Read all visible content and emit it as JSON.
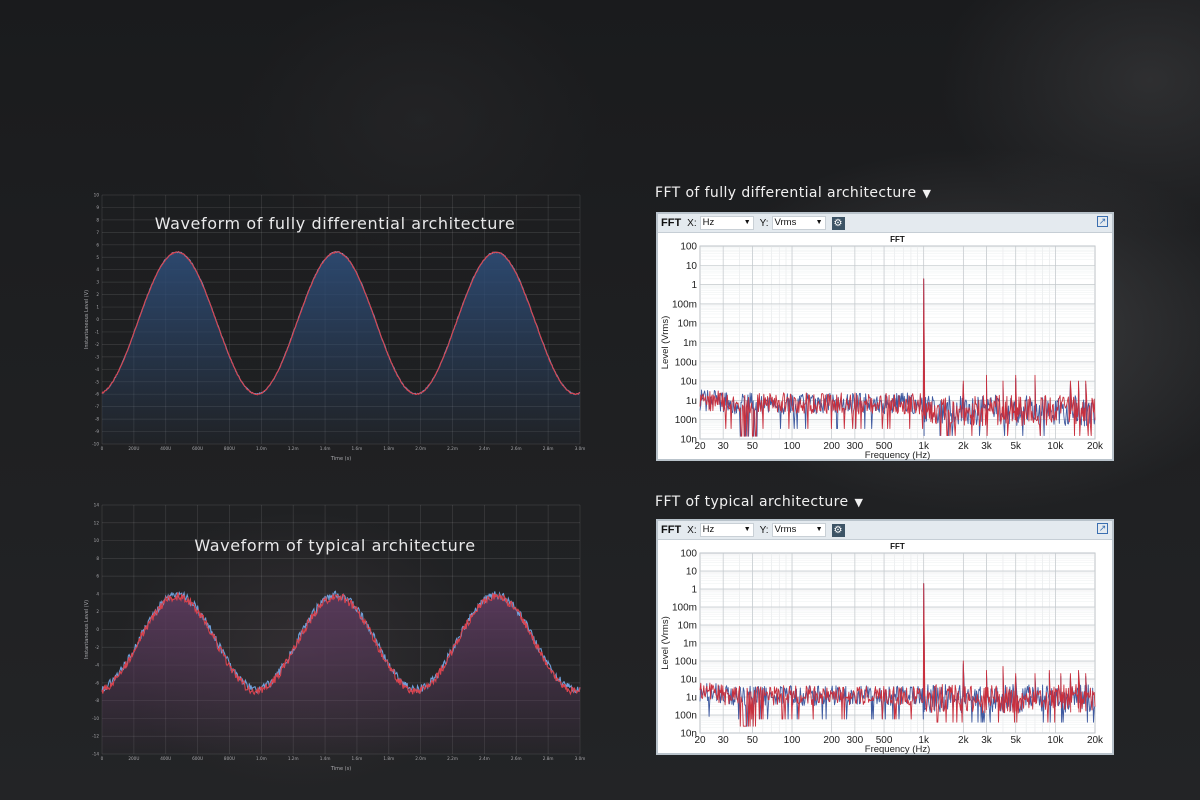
{
  "chart_data": [
    {
      "type": "line",
      "title": "Waveform of fully differential architecture",
      "xlabel": "Time (s)",
      "ylabel": "Instantaneous Level (V)",
      "x_ticks": [
        "0",
        "200U",
        "400U",
        "600U",
        "800U",
        "1.0m",
        "1.2m",
        "1.4m",
        "1.6m",
        "1.8m",
        "2.0m",
        "2.2m",
        "2.4m",
        "2.6m",
        "2.8m",
        "3.0m"
      ],
      "y_ticks": [
        "10",
        "9",
        "8",
        "7",
        "6",
        "5",
        "4",
        "3",
        "2",
        "1",
        "0",
        "-1",
        "-2",
        "-3",
        "-4",
        "-5",
        "-6",
        "-7",
        "-8",
        "-9",
        "-10"
      ],
      "xlim": [
        0,
        3.0
      ],
      "ylim": [
        -10,
        10
      ],
      "grid": true,
      "signal": {
        "amplitude": 5.7,
        "offset": -0.3,
        "cycles": 3,
        "start_phase_deg": 190,
        "noise": 0.05
      },
      "series": [
        {
          "color": "#d9434e"
        },
        {
          "color": "#6fa0da"
        }
      ],
      "fill_color": "#2d4a72"
    },
    {
      "type": "line",
      "title": "Waveform of typical architecture",
      "xlabel": "Time (s)",
      "ylabel": "Instantaneous Level (V)",
      "x_ticks": [
        "0",
        "200U",
        "400U",
        "600U",
        "800U",
        "1.0m",
        "1.2m",
        "1.4m",
        "1.6m",
        "1.8m",
        "2.0m",
        "2.2m",
        "2.4m",
        "2.6m",
        "2.8m",
        "3.0m"
      ],
      "y_ticks": [
        "14",
        "12",
        "10",
        "8",
        "6",
        "4",
        "2",
        "0",
        "-2",
        "-4",
        "-6",
        "-8",
        "-10",
        "-12",
        "-14"
      ],
      "xlim": [
        0,
        3.0
      ],
      "ylim": [
        -14,
        14
      ],
      "grid": true,
      "signal": {
        "amplitude": 5.3,
        "offset": -1.6,
        "cycles": 3,
        "start_phase_deg": 190,
        "noise": 0.45
      },
      "series": [
        {
          "color": "#d9434e"
        },
        {
          "color": "#6fa0da"
        }
      ],
      "fill_color": "#5a3a5c"
    },
    {
      "type": "line",
      "title": "FFT",
      "heading": "FFT of fully differential architecture",
      "xlabel": "Frequency (Hz)",
      "ylabel": "Level (Vrms)",
      "x_scale": "log",
      "y_scale": "log",
      "xlim": [
        20,
        20000
      ],
      "ylim": [
        1e-08,
        100
      ],
      "x_ticks": [
        {
          "v": 20,
          "t": "20"
        },
        {
          "v": 30,
          "t": "30"
        },
        {
          "v": 50,
          "t": "50"
        },
        {
          "v": 100,
          "t": "100"
        },
        {
          "v": 200,
          "t": "200"
        },
        {
          "v": 300,
          "t": "300"
        },
        {
          "v": 500,
          "t": "500"
        },
        {
          "v": 1000,
          "t": "1k"
        },
        {
          "v": 2000,
          "t": "2k"
        },
        {
          "v": 3000,
          "t": "3k"
        },
        {
          "v": 5000,
          "t": "5k"
        },
        {
          "v": 10000,
          "t": "10k"
        },
        {
          "v": 20000,
          "t": "20k"
        }
      ],
      "y_ticks": [
        {
          "v": 100,
          "t": "100"
        },
        {
          "v": 10,
          "t": "10"
        },
        {
          "v": 1,
          "t": "1"
        },
        {
          "v": 0.1,
          "t": "100m"
        },
        {
          "v": 0.01,
          "t": "10m"
        },
        {
          "v": 0.001,
          "t": "1m"
        },
        {
          "v": 0.0001,
          "t": "100u"
        },
        {
          "v": 1e-05,
          "t": "10u"
        },
        {
          "v": 1e-06,
          "t": "1u"
        },
        {
          "v": 1e-07,
          "t": "100n"
        },
        {
          "v": 1e-08,
          "t": "10n"
        }
      ],
      "toolbar": {
        "title": "FFT",
        "x_label": "X:",
        "x_unit": "Hz",
        "y_label": "Y:",
        "y_unit": "Vrms"
      },
      "fundamental": {
        "freq": 1000,
        "level": 2
      },
      "harmonics": [
        {
          "freq": 2000,
          "level": 1e-05
        },
        {
          "freq": 3000,
          "level": 2e-05
        },
        {
          "freq": 4000,
          "level": 1e-05
        },
        {
          "freq": 5000,
          "level": 2e-05
        },
        {
          "freq": 7000,
          "level": 2e-05
        },
        {
          "freq": 13000,
          "level": 1e-05
        },
        {
          "freq": 15000,
          "level": 1e-05
        },
        {
          "freq": 17000,
          "level": 1e-05
        }
      ],
      "noise_floor": {
        "low_band": 7e-07,
        "high_band": 3e-07
      },
      "series": [
        {
          "color": "#c8303e"
        },
        {
          "color": "#3f5aa0"
        }
      ]
    },
    {
      "type": "line",
      "title": "FFT",
      "heading": "FFT of typical architecture",
      "xlabel": "Frequency (Hz)",
      "ylabel": "Level (Vrms)",
      "x_scale": "log",
      "y_scale": "log",
      "xlim": [
        20,
        20000
      ],
      "ylim": [
        1e-08,
        100
      ],
      "x_ticks": [
        {
          "v": 20,
          "t": "20"
        },
        {
          "v": 30,
          "t": "30"
        },
        {
          "v": 50,
          "t": "50"
        },
        {
          "v": 100,
          "t": "100"
        },
        {
          "v": 200,
          "t": "200"
        },
        {
          "v": 300,
          "t": "300"
        },
        {
          "v": 500,
          "t": "500"
        },
        {
          "v": 1000,
          "t": "1k"
        },
        {
          "v": 2000,
          "t": "2k"
        },
        {
          "v": 3000,
          "t": "3k"
        },
        {
          "v": 5000,
          "t": "5k"
        },
        {
          "v": 10000,
          "t": "10k"
        },
        {
          "v": 20000,
          "t": "20k"
        }
      ],
      "y_ticks": [
        {
          "v": 100,
          "t": "100"
        },
        {
          "v": 10,
          "t": "10"
        },
        {
          "v": 1,
          "t": "1"
        },
        {
          "v": 0.1,
          "t": "100m"
        },
        {
          "v": 0.01,
          "t": "10m"
        },
        {
          "v": 0.001,
          "t": "1m"
        },
        {
          "v": 0.0001,
          "t": "100u"
        },
        {
          "v": 1e-05,
          "t": "10u"
        },
        {
          "v": 1e-06,
          "t": "1u"
        },
        {
          "v": 1e-07,
          "t": "100n"
        },
        {
          "v": 1e-08,
          "t": "10n"
        }
      ],
      "toolbar": {
        "title": "FFT",
        "x_label": "X:",
        "x_unit": "Hz",
        "y_label": "Y:",
        "y_unit": "Vrms"
      },
      "fundamental": {
        "freq": 1000,
        "level": 2
      },
      "harmonics": [
        {
          "freq": 2000,
          "level": 0.0001
        },
        {
          "freq": 3000,
          "level": 3e-05
        },
        {
          "freq": 4000,
          "level": 5e-05
        },
        {
          "freq": 5000,
          "level": 2e-05
        },
        {
          "freq": 7000,
          "level": 2e-05
        },
        {
          "freq": 9000,
          "level": 3e-05
        },
        {
          "freq": 11000,
          "level": 2e-05
        },
        {
          "freq": 13000,
          "level": 2e-05
        },
        {
          "freq": 15000,
          "level": 3e-05
        },
        {
          "freq": 17000,
          "level": 2e-05
        }
      ],
      "noise_floor": {
        "low_band": 1.2e-06,
        "high_band": 8e-07
      },
      "series": [
        {
          "color": "#c8303e"
        },
        {
          "color": "#3f5aa0"
        }
      ]
    }
  ]
}
